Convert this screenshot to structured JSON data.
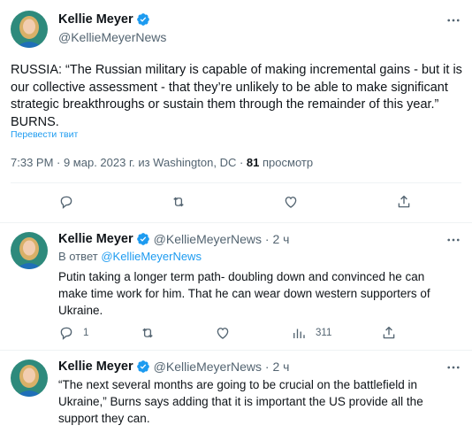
{
  "main_tweet": {
    "display_name": "Kellie Meyer",
    "handle": "@KellieMeyerNews",
    "text": "RUSSIA: “The Russian military is capable of making incremental gains - but it is our collective assessment - that they’re unlikely to be able to make significant strategic breakthroughs or sustain them through the remainder of this year.” BURNS.",
    "translate_label": "Перевести твит",
    "timestamp": "7:33 PM · 9 мар. 2023 г. из Washington, DC ·",
    "views_count": "81",
    "views_label": "просмотр",
    "more_icon": "more-dots-icon"
  },
  "replies": [
    {
      "display_name": "Kellie Meyer",
      "handle_time": "@KellieMeyerNews · 2 ч",
      "reply_prefix": "В ответ",
      "reply_link": "@KellieMeyerNews",
      "text": "Putin taking a longer term path- doubling down and convinced he can make time work for him. That he can wear down western supporters of Ukraine.",
      "reply_count": "1",
      "views_count": "311"
    },
    {
      "display_name": "Kellie Meyer",
      "handle_time": "@KellieMeyerNews · 2 ч",
      "text": "“The next several months are going to be crucial on the battlefield in Ukraine,” Burns says adding that it is important the US provide all the support they can."
    }
  ],
  "colors": {
    "text": "#0f1419",
    "secondary": "#536471",
    "accent": "#1d9bf0",
    "border": "#eff3f4"
  }
}
